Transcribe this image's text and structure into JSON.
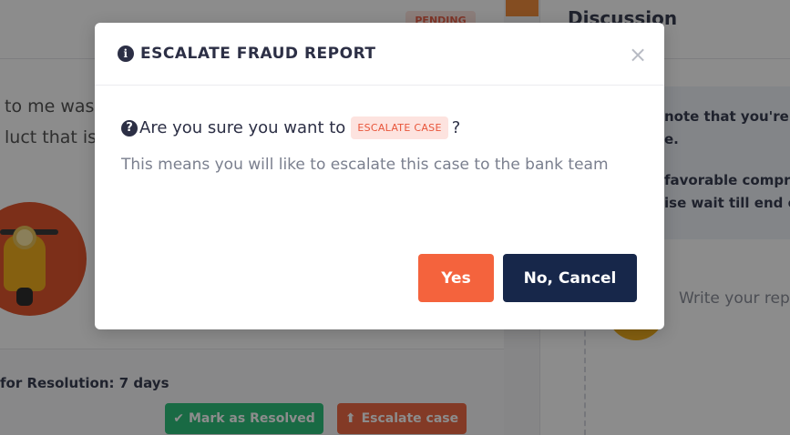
{
  "background": {
    "status_badge": "PENDING",
    "description_lines": [
      "to me was",
      "luct that is to"
    ],
    "resolution_text": "for Resolution: 7 days",
    "mark_resolved_label": "Mark as Resolved",
    "escalate_label": "Escalate case",
    "discussion_title": "Discussion",
    "notice_lines_1": [
      "note that you're li",
      "e."
    ],
    "notice_lines_2": [
      "favorable compro",
      "ise wait till end of"
    ],
    "reply_placeholder": "Write your repl"
  },
  "modal": {
    "title": "ESCALATE FRAUD REPORT",
    "close_symbol": "×",
    "question_prefix": "Are you sure you want to",
    "question_badge": "ESCALATE CASE",
    "question_suffix": "?",
    "explanation": "This means you will like to escalate this case to the bank team",
    "yes_label": "Yes",
    "cancel_label": "No, Cancel"
  },
  "colors": {
    "overlay": "rgba(0,0,0,0.45)",
    "yes_button": "#f4633d",
    "cancel_button": "#17274a",
    "badge_bg": "#fde3df",
    "badge_text": "#e8553a",
    "resolved_button": "#2fc27c",
    "escalate_button": "#ef6a45"
  },
  "icons": {
    "title_icon": "info-icon",
    "question_icon": "question-circle-icon",
    "close_icon": "close-icon",
    "check_icon": "check-icon",
    "escalate_icon": "escalate-icon"
  }
}
